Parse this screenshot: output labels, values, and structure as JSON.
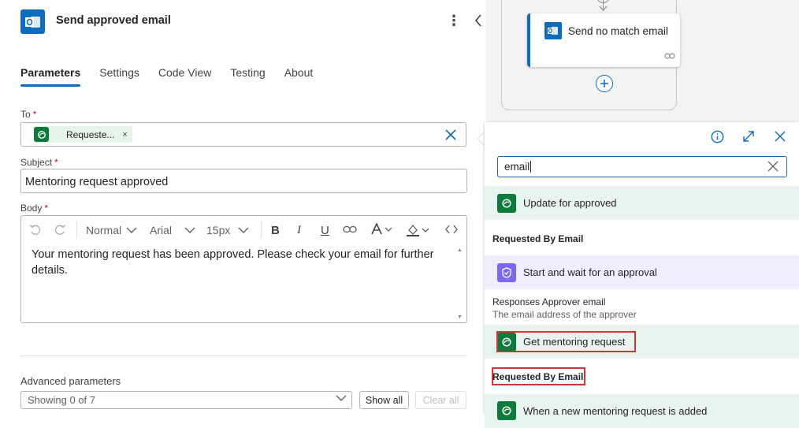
{
  "header": {
    "title": "Send approved email",
    "more_icon": "more-vertical-icon",
    "collapse_icon": "chevron-left-icon"
  },
  "tabs": [
    {
      "label": "Parameters",
      "active": true
    },
    {
      "label": "Settings",
      "active": false
    },
    {
      "label": "Code View",
      "active": false
    },
    {
      "label": "Testing",
      "active": false
    },
    {
      "label": "About",
      "active": false
    }
  ],
  "fields": {
    "to": {
      "label": "To",
      "required_mark": "*",
      "token_label": "Requeste...",
      "token_close": "×"
    },
    "subject": {
      "label": "Subject",
      "required_mark": "*",
      "value": "Mentoring request approved"
    },
    "body": {
      "label": "Body",
      "required_mark": "*",
      "toolbar": {
        "format": "Normal",
        "font": "Arial",
        "size": "15px",
        "bold": "B",
        "italic": "I",
        "underline": "U"
      },
      "value": "Your mentoring request has been approved. Please check your email for further details."
    }
  },
  "advanced": {
    "label": "Advanced parameters",
    "select_value": "Showing 0 of 7",
    "show_all": "Show all",
    "clear_all": "Clear all"
  },
  "canvas": {
    "card_title": "Send no match email"
  },
  "flyout": {
    "search_value": "email",
    "groups": [
      {
        "title": "Update for approved",
        "color": "green",
        "items": [
          {
            "label": "Requested By Email",
            "desc": ""
          }
        ]
      },
      {
        "title": "Start and wait for an approval",
        "color": "purple",
        "items": [
          {
            "label": "Responses Approver email",
            "desc": "The email address of the approver"
          }
        ]
      },
      {
        "title": "Get mentoring request",
        "color": "green",
        "items": [
          {
            "label": "Requested By Email",
            "desc": ""
          }
        ]
      },
      {
        "title": "When a new mentoring request is added",
        "color": "green",
        "items": []
      }
    ]
  },
  "colors": {
    "accent": "#0f6cbd",
    "required": "#c50f1f",
    "highlight": "#d13438",
    "dataverse_green": "#0e7a3b",
    "approval_purple": "#7b68ee"
  }
}
